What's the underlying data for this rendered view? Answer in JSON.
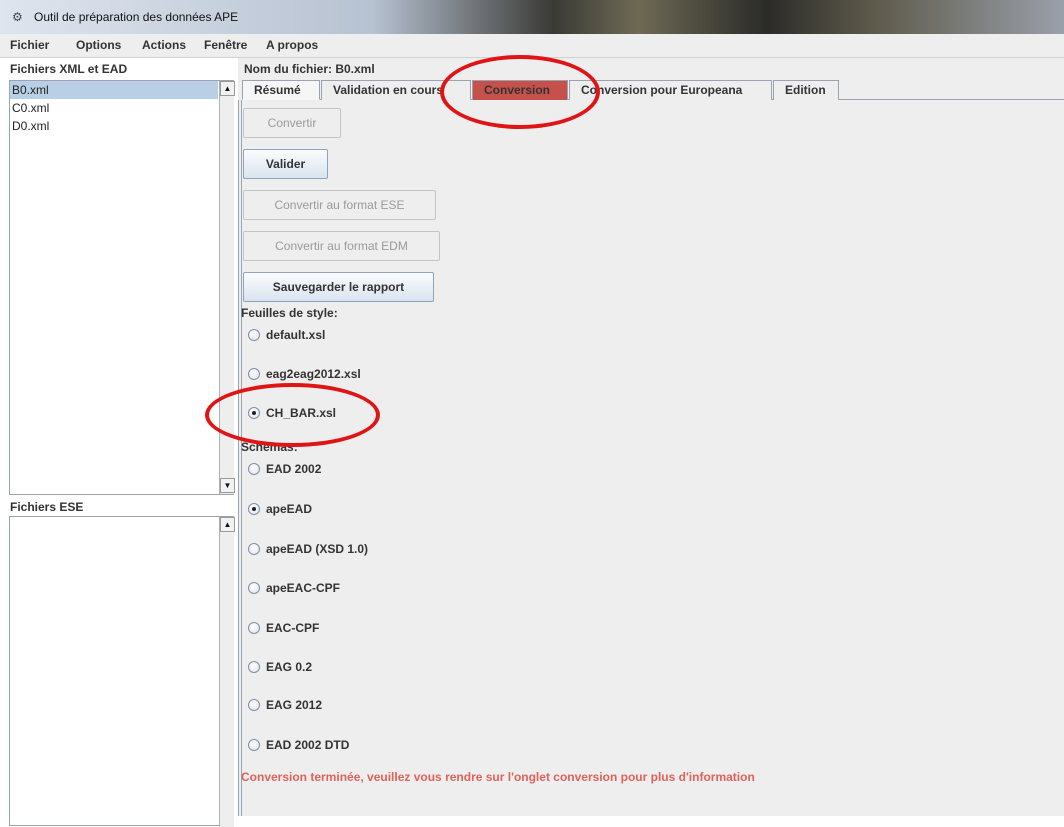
{
  "window": {
    "title": "Outil de préparation des données APE",
    "app_icon": "settings-gear-icon"
  },
  "menubar": {
    "items": [
      "Fichier",
      "Options",
      "Actions",
      "Fenêtre",
      "A propos"
    ]
  },
  "left_panel": {
    "xml_label": "Fichiers XML et EAD",
    "xml_files": [
      {
        "name": "B0.xml",
        "selected": true
      },
      {
        "name": "C0.xml",
        "selected": false
      },
      {
        "name": "D0.xml",
        "selected": false
      }
    ],
    "ese_label": "Fichiers ESE",
    "ese_files": []
  },
  "right_panel": {
    "filename_label": "Nom du fichier: B0.xml",
    "tabs": [
      {
        "label": "Résumé",
        "state": "active"
      },
      {
        "label": "Validation en cours",
        "state": "normal"
      },
      {
        "label": "Conversion",
        "state": "highlighted"
      },
      {
        "label": "Conversion pour Europeana",
        "state": "normal"
      },
      {
        "label": "Edition",
        "state": "normal"
      }
    ],
    "buttons": {
      "convertir": "Convertir",
      "valider": "Valider",
      "convertir_ese": "Convertir au format ESE",
      "convertir_edm": "Convertir au format EDM",
      "sauvegarder": "Sauvegarder le rapport"
    },
    "stylesheets_label": "Feuilles de style:",
    "stylesheets": [
      {
        "label": "default.xsl",
        "checked": false
      },
      {
        "label": "eag2eag2012.xsl",
        "checked": false
      },
      {
        "label": "CH_BAR.xsl",
        "checked": true
      }
    ],
    "schemas_label": "Schémas:",
    "schemas": [
      {
        "label": "EAD 2002",
        "checked": false
      },
      {
        "label": "apeEAD",
        "checked": true
      },
      {
        "label": "apeEAD (XSD 1.0)",
        "checked": false
      },
      {
        "label": "apeEAC-CPF",
        "checked": false
      },
      {
        "label": "EAC-CPF",
        "checked": false
      },
      {
        "label": "EAG 0.2",
        "checked": false
      },
      {
        "label": "EAG 2012",
        "checked": false
      },
      {
        "label": "EAD 2002 DTD",
        "checked": false
      }
    ],
    "status_message": "Conversion terminée, veuillez vous rendre sur l'onglet conversion pour plus d'information"
  },
  "annotation_color": "#e01414",
  "highlight_tab_color": "#c6504a",
  "status_color": "#e0625a"
}
